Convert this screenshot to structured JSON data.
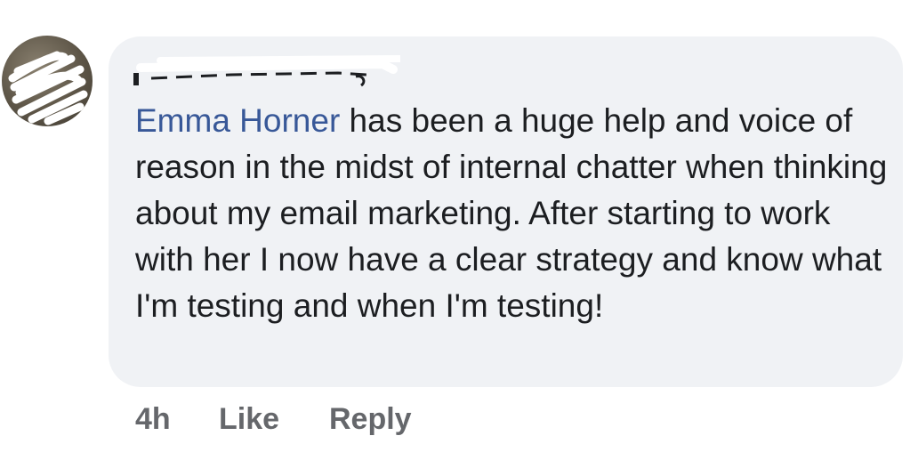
{
  "comment": {
    "author_name": "",
    "mention": "Emma Horner",
    "body": " has been a huge help and voice of reason in the midst of internal chatter when thinking about my email marketing. After starting to work with her I now have a clear strategy and know what I'm testing and when I'm testing!",
    "timestamp": "4h",
    "like_label": "Like",
    "reply_label": "Reply"
  },
  "colors": {
    "bubble_bg": "#f0f2f5",
    "mention": "#385898",
    "text": "#1c1e21",
    "action_text": "#65676b"
  }
}
